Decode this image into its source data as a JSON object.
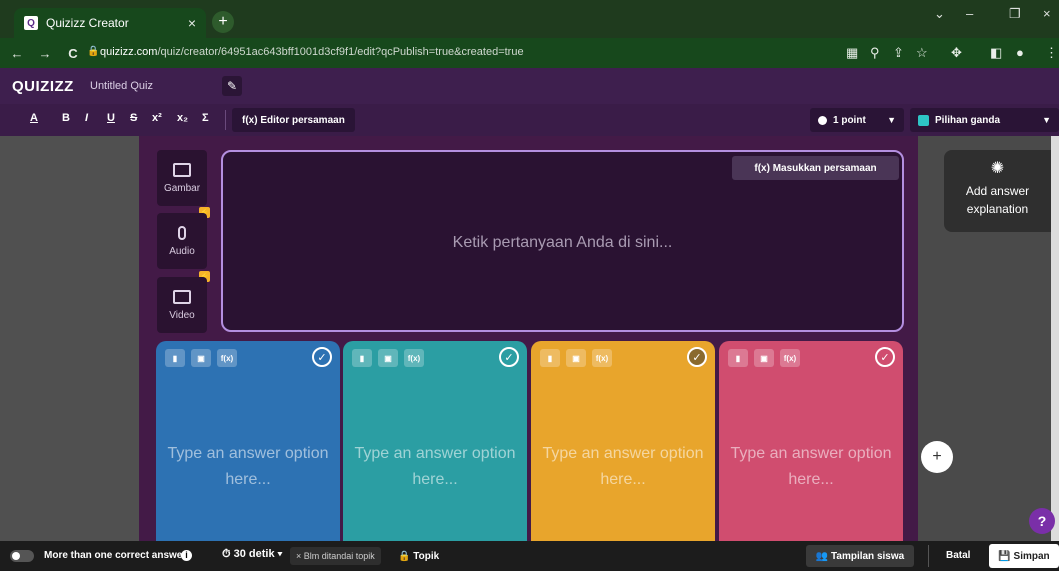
{
  "browser": {
    "tab_title": "Quizizz Creator",
    "tab_close": "×",
    "new_tab": "+",
    "url_host": "quizizz.com",
    "url_path": "/quiz/creator/64951ac643bff1001d3cf9f1/edit?qcPublish=true&created=true",
    "back": "←",
    "forward": "→",
    "reload": "C",
    "lock": "🔒",
    "min": "–",
    "max": "❐",
    "close": "×",
    "chevron": "⌄"
  },
  "header": {
    "logo": "QUIZIZZ",
    "quiz_name": "Untitled Quiz"
  },
  "toolbar": {
    "format_buttons": [
      "A",
      "B",
      "I",
      "U",
      "S",
      "x²",
      "x₂",
      "Σ"
    ],
    "eq_editor": "f(x) Editor persamaan",
    "points": "1 point",
    "question_type": "Pilihan ganda"
  },
  "question": {
    "placeholder": "Ketik pertanyaan Anda di sini...",
    "insert_eq": "f(x) Masukkan persamaan"
  },
  "media": {
    "image": "Gambar",
    "audio": "Audio",
    "video": "Video"
  },
  "explanation": {
    "label": "Add answer explanation"
  },
  "answers": [
    {
      "placeholder": "Type an answer option here...",
      "color": "#2d72b3"
    },
    {
      "placeholder": "Type an answer option here...",
      "color": "#2b9ea3"
    },
    {
      "placeholder": "Type an answer option here...",
      "color": "#e8a52c"
    },
    {
      "placeholder": "Type an answer option here...",
      "color": "#d04d6f"
    }
  ],
  "answer_tools": [
    "▮",
    "▣",
    "f(x)"
  ],
  "bottom": {
    "multi_correct": "More than one correct answer",
    "timer": "30 detik",
    "topic_tag": "× Blm ditandai topik",
    "topic_btn": "Topik",
    "student_view": "Tampilan siswa",
    "cancel": "Batal",
    "save": "Simpan"
  },
  "help": "?",
  "add": "+"
}
